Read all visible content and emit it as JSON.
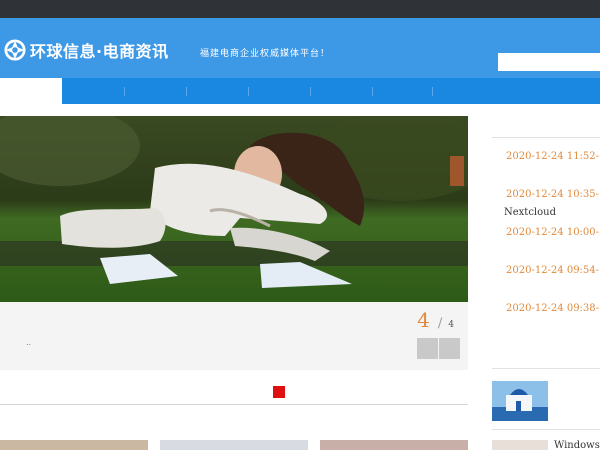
{
  "site": {
    "brand": "环球信息·电商资讯",
    "slogan": "福建电商企业权威媒体平台！",
    "search_placeholder": ""
  },
  "nav": {
    "item_count": 7
  },
  "slider": {
    "caption": "..",
    "current": "4",
    "separator": "/",
    "total": "4"
  },
  "sidebar": {
    "news": [
      {
        "date": "2020-12-24 11:52-"
      },
      {
        "date": "2020-12-24 10:35-",
        "title": "Nextcloud"
      },
      {
        "date": "2020-12-24 10:00-"
      },
      {
        "date": "2020-12-24 09:54-"
      },
      {
        "date": "2020-12-24 09:38-"
      }
    ],
    "image_items": [
      {
        "label": ""
      },
      {
        "label": "Windows"
      }
    ]
  },
  "colors": {
    "header_blue": "#3d98e6",
    "nav_blue": "#1a87e0",
    "accent_orange": "#e08a3c",
    "indicator_red": "#e01010"
  }
}
